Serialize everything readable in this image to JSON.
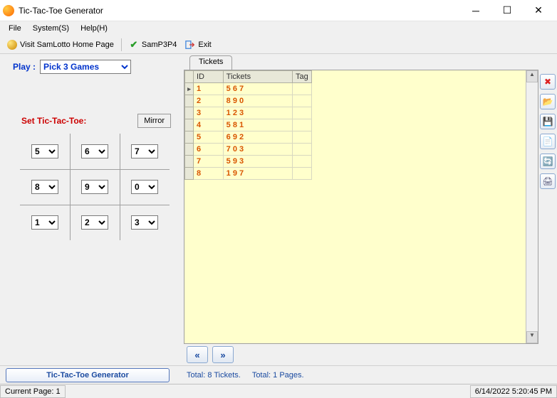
{
  "window": {
    "title": "Tic-Tac-Toe Generator"
  },
  "menu": {
    "file": "File",
    "system": "System(S)",
    "help": "Help(H)"
  },
  "toolbar": {
    "visit": "Visit SamLotto Home Page",
    "samp": "SamP3P4",
    "exit": "Exit"
  },
  "play": {
    "label": "Play :",
    "value": "Pick 3 Games"
  },
  "ttt": {
    "label": "Set Tic-Tac-Toe:",
    "mirror": "Mirror",
    "cells": [
      "5",
      "6",
      "7",
      "8",
      "9",
      "0",
      "1",
      "2",
      "3"
    ]
  },
  "tab": {
    "tickets": "Tickets"
  },
  "grid": {
    "headers": {
      "id": "ID",
      "tickets": "Tickets",
      "tag": "Tag"
    },
    "rows": [
      {
        "id": "1",
        "tickets": "5 6 7",
        "tag": ""
      },
      {
        "id": "2",
        "tickets": "8 9 0",
        "tag": ""
      },
      {
        "id": "3",
        "tickets": "1 2 3",
        "tag": ""
      },
      {
        "id": "4",
        "tickets": "5 8 1",
        "tag": ""
      },
      {
        "id": "5",
        "tickets": "6 9 2",
        "tag": ""
      },
      {
        "id": "6",
        "tickets": "7 0 3",
        "tag": ""
      },
      {
        "id": "7",
        "tickets": "5 9 3",
        "tag": ""
      },
      {
        "id": "8",
        "tickets": "1 9 7",
        "tag": ""
      }
    ]
  },
  "bottom": {
    "generate": "Tic-Tac-Toe Generator",
    "total_tickets": "Total: 8 Tickets.",
    "total_pages": "Total: 1 Pages."
  },
  "status": {
    "page": "Current Page: 1",
    "datetime": "6/14/2022 5:20:45 PM"
  }
}
